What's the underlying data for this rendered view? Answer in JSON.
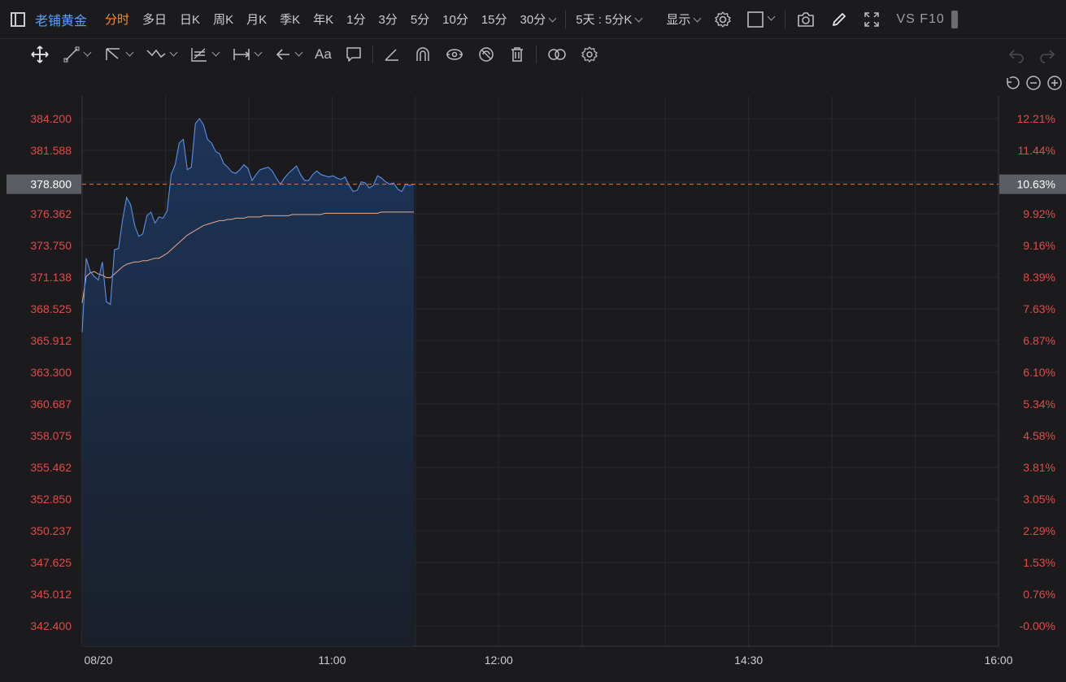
{
  "symbol": {
    "name": "老铺黄金",
    "color": "#5aa0ff"
  },
  "periods": [
    {
      "label": "分时",
      "active": true
    },
    {
      "label": "多日"
    },
    {
      "label": "日K"
    },
    {
      "label": "周K"
    },
    {
      "label": "月K"
    },
    {
      "label": "季K"
    },
    {
      "label": "年K"
    },
    {
      "label": "1分"
    },
    {
      "label": "3分"
    },
    {
      "label": "5分"
    },
    {
      "label": "10分"
    },
    {
      "label": "15分"
    },
    {
      "label": "30分",
      "dropdown": true
    }
  ],
  "combo_label": "5天 : 5分K",
  "display_label": "显示",
  "vs_label": "VS F10",
  "drawing_tools_icons": [
    "move-icon",
    "line-icon",
    "polyline-icon",
    "wave-icon",
    "fib-icon",
    "measure-icon",
    "arrow-icon",
    "text-icon",
    "comment-icon",
    "ruler-icon",
    "magnet-icon",
    "eye-icon",
    "hide-icon",
    "trash-icon",
    "link-icon",
    "settings-icon",
    "undo-icon",
    "redo-icon"
  ],
  "text_tool_label": "Aa",
  "chart_data": {
    "type": "line",
    "title": "",
    "x_ticks": [
      "08/20",
      "11:00",
      "12:00",
      "14:30",
      "16:00"
    ],
    "y_ticks_left": [
      "384.200",
      "381.588",
      "378.800",
      "376.362",
      "373.750",
      "371.138",
      "368.525",
      "365.912",
      "363.300",
      "360.687",
      "358.075",
      "355.462",
      "352.850",
      "350.237",
      "347.625",
      "345.012",
      "342.400"
    ],
    "y_ticks_right": [
      "12.21%",
      "11.44%",
      "10.63%",
      "9.92%",
      "9.16%",
      "8.39%",
      "7.63%",
      "6.87%",
      "6.10%",
      "5.34%",
      "4.58%",
      "3.81%",
      "3.05%",
      "2.29%",
      "1.53%",
      "0.76%",
      "-0.00%"
    ],
    "ylim": [
      342.4,
      384.2
    ],
    "current_price_label": "378.800",
    "current_pct_label": "10.63%",
    "current_price": 378.8,
    "series": [
      {
        "role": "price",
        "color": "#5b8fe6",
        "values": [
          366.6,
          372.7,
          371.6,
          371.2,
          370.9,
          372.4,
          369.1,
          368.9,
          373.4,
          373.5,
          375.9,
          377.7,
          377.1,
          375.4,
          374.5,
          374.7,
          376.2,
          376.5,
          375.6,
          376.1,
          376.0,
          376.6,
          379.6,
          380.4,
          382.2,
          382.5,
          380.0,
          380.2,
          383.8,
          384.2,
          383.7,
          382.5,
          382.2,
          381.5,
          381.3,
          380.5,
          380.2,
          379.8,
          379.7,
          380.0,
          380.4,
          380.1,
          379.1,
          379.6,
          380.0,
          380.1,
          380.2,
          379.9,
          379.3,
          378.8,
          379.3,
          379.7,
          380.0,
          380.3,
          379.6,
          379.1,
          379.1,
          379.6,
          379.9,
          379.6,
          379.5,
          379.4,
          379.5,
          379.3,
          379.2,
          379.4,
          378.7,
          378.2,
          378.3,
          379.0,
          378.9,
          378.5,
          378.7,
          379.5,
          379.3,
          379.0,
          378.8,
          378.9,
          378.4,
          378.2,
          378.8,
          378.7,
          378.8
        ]
      },
      {
        "role": "average",
        "color": "#e8a888",
        "values": [
          369.0,
          371.2,
          371.5,
          371.6,
          371.4,
          371.3,
          371.1,
          371.1,
          371.4,
          371.7,
          372.0,
          372.2,
          372.3,
          372.4,
          372.4,
          372.5,
          372.5,
          372.6,
          372.7,
          372.7,
          372.9,
          373.1,
          373.4,
          373.7,
          374.0,
          374.3,
          374.6,
          374.8,
          375.0,
          375.2,
          375.4,
          375.5,
          375.6,
          375.7,
          375.8,
          375.8,
          375.9,
          375.9,
          376.0,
          376.0,
          376.0,
          376.1,
          376.1,
          376.1,
          376.1,
          376.2,
          376.2,
          376.2,
          376.2,
          376.2,
          376.2,
          376.2,
          376.3,
          376.3,
          376.3,
          376.3,
          376.3,
          376.3,
          376.3,
          376.3,
          376.4,
          376.4,
          376.4,
          376.4,
          376.4,
          376.4,
          376.4,
          376.4,
          376.4,
          376.4,
          376.4,
          376.4,
          376.4,
          376.4,
          376.5,
          376.5,
          376.5,
          376.5,
          376.5,
          376.5,
          376.5,
          376.5,
          376.5
        ]
      }
    ],
    "session_fraction_elapsed": 0.362
  }
}
